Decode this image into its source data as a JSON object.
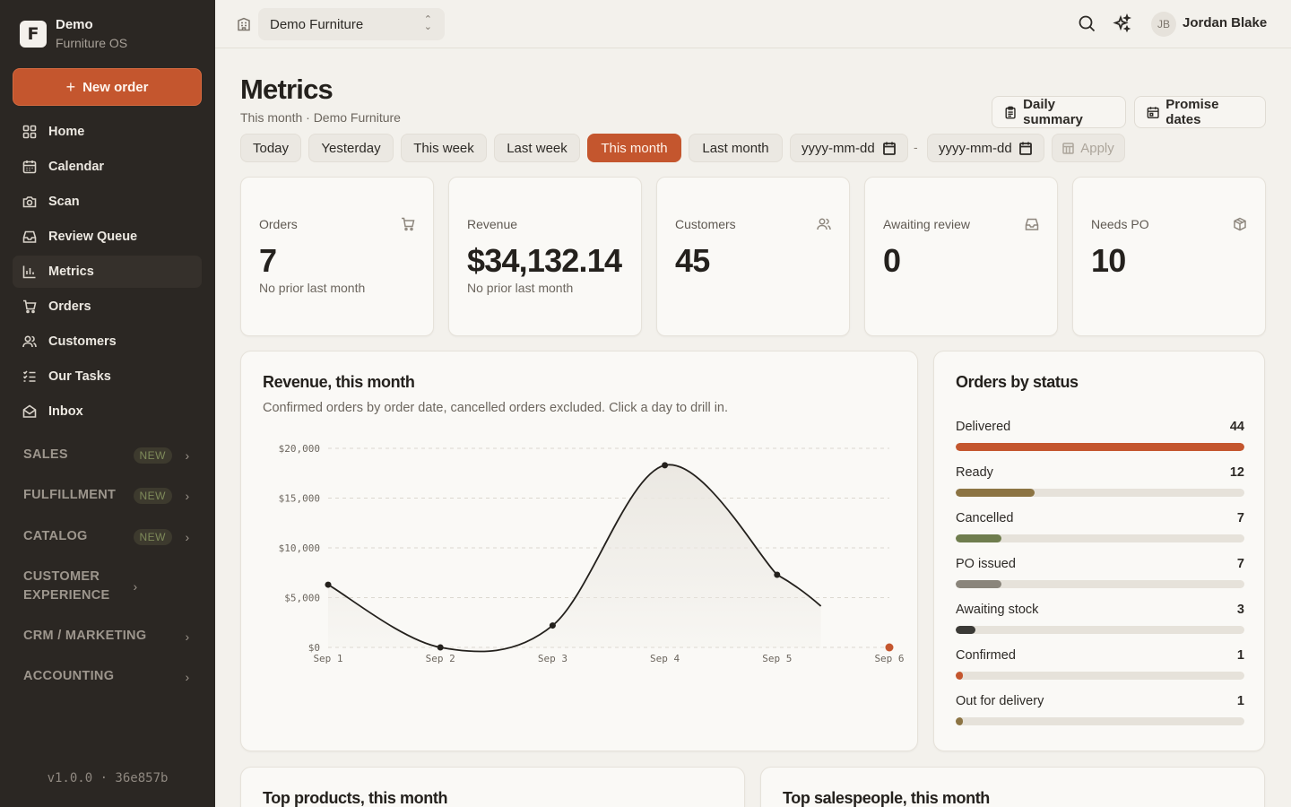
{
  "brand": {
    "logo_letter": "F",
    "name": "Demo",
    "subtitle": "Furniture OS"
  },
  "sidebar": {
    "new_order_label": "New order",
    "items": [
      {
        "label": "Home",
        "icon": "grid-icon"
      },
      {
        "label": "Calendar",
        "icon": "calendar-icon"
      },
      {
        "label": "Scan",
        "icon": "camera-icon"
      },
      {
        "label": "Review Queue",
        "icon": "inbox-tray-icon"
      },
      {
        "label": "Metrics",
        "icon": "bar-chart-icon",
        "active": true
      },
      {
        "label": "Orders",
        "icon": "cart-icon"
      },
      {
        "label": "Customers",
        "icon": "users-icon"
      },
      {
        "label": "Our Tasks",
        "icon": "task-list-icon"
      },
      {
        "label": "Inbox",
        "icon": "mail-icon"
      }
    ],
    "sections": [
      {
        "label": "SALES",
        "badge": "NEW"
      },
      {
        "label": "FULFILLMENT",
        "badge": "NEW"
      },
      {
        "label": "CATALOG",
        "badge": "NEW"
      },
      {
        "label": "CUSTOMER EXPERIENCE",
        "badge": ""
      },
      {
        "label": "CRM / MARKETING",
        "badge": ""
      },
      {
        "label": "ACCOUNTING",
        "badge": ""
      }
    ],
    "version": "v1.0.0 · 36e857b"
  },
  "topbar": {
    "org_name": "Demo Furniture",
    "user_initials": "JB",
    "user_name": "Jordan Blake",
    "icons": [
      "building-icon",
      "search-icon",
      "sparkles-icon"
    ]
  },
  "header": {
    "title": "Metrics",
    "subtitle": "This month · Demo Furniture",
    "daily_summary_label": "Daily summary",
    "promise_dates_label": "Promise dates"
  },
  "filters": {
    "ranges": [
      "Today",
      "Yesterday",
      "This week",
      "Last week",
      "This month",
      "Last month"
    ],
    "active": "This month",
    "date_from_placeholder": "yyyy-mm-dd",
    "date_separator": "-",
    "date_to_placeholder": "yyyy-mm-dd",
    "apply_label": "Apply"
  },
  "kpis": [
    {
      "label": "Orders",
      "value": "7",
      "note": "No prior last month",
      "icon": "cart-icon"
    },
    {
      "label": "Revenue",
      "value": "$34,132.14",
      "note": "No prior last month",
      "icon": ""
    },
    {
      "label": "Customers",
      "value": "45",
      "note": "",
      "icon": "users-icon"
    },
    {
      "label": "Awaiting review",
      "value": "0",
      "note": "",
      "icon": "inbox-tray-icon"
    },
    {
      "label": "Needs PO",
      "value": "10",
      "note": "",
      "icon": "package-icon"
    }
  ],
  "revenue_panel": {
    "title": "Revenue, this month",
    "subtitle": "Confirmed orders by order date, cancelled orders excluded. Click a day to drill in."
  },
  "chart_data": {
    "type": "area",
    "categories": [
      "Sep 1",
      "Sep 2",
      "Sep 3",
      "Sep 4",
      "Sep 5",
      "Sep 6"
    ],
    "series": [
      {
        "values": [
          6300,
          0,
          2200,
          18300,
          7300,
          0
        ]
      }
    ],
    "yticks": [
      "$20,000",
      "$15,000",
      "$10,000",
      "$5,000",
      "$0"
    ],
    "ytick_values": [
      20000,
      15000,
      10000,
      5000,
      0
    ],
    "ylim": [
      0,
      20000
    ],
    "grid": true,
    "colors": {
      "line": "#24211d",
      "fill": "#ebe8e2",
      "highlight": "#c4562e"
    }
  },
  "status_panel": {
    "title": "Orders by status",
    "max": 44,
    "rows": [
      {
        "name": "Delivered",
        "count": 44,
        "color": "#c4562e"
      },
      {
        "name": "Ready",
        "count": 12,
        "color": "#8c7443"
      },
      {
        "name": "Cancelled",
        "count": 7,
        "color": "#6f7d4e"
      },
      {
        "name": "PO issued",
        "count": 7,
        "color": "#8a857b"
      },
      {
        "name": "Awaiting stock",
        "count": 3,
        "color": "#3b3a36"
      },
      {
        "name": "Confirmed",
        "count": 1,
        "color": "#c4562e"
      },
      {
        "name": "Out for delivery",
        "count": 1,
        "color": "#8c7443"
      }
    ]
  },
  "bottom_panels": {
    "top_products_title": "Top products, this month",
    "top_salespeople_title": "Top salespeople, this month"
  }
}
